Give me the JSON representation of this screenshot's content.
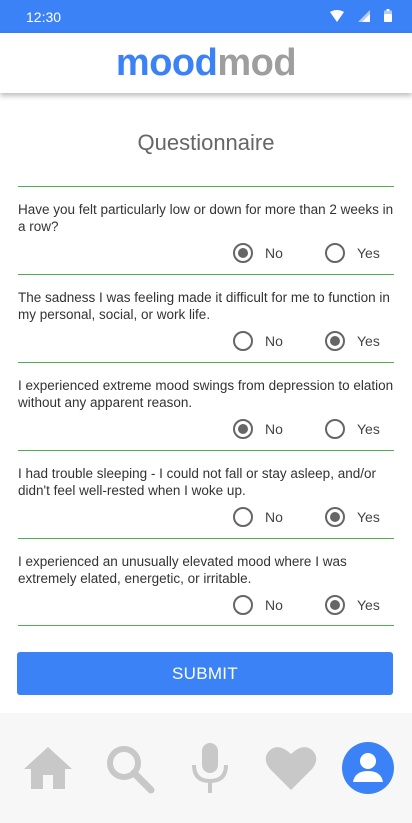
{
  "status_bar": {
    "time": "12:30"
  },
  "app": {
    "logo_part1": "mood",
    "logo_part2": "mod"
  },
  "page": {
    "title": "Questionnaire"
  },
  "questions": [
    {
      "text": "Have you felt particularly low or down for more than 2 weeks in a row?",
      "no_label": "No",
      "yes_label": "Yes",
      "selected": "No"
    },
    {
      "text": "The sadness I was feeling made it difficult for me to function in my personal, social, or work life.",
      "no_label": "No",
      "yes_label": "Yes",
      "selected": "Yes"
    },
    {
      "text": "I experienced extreme mood swings from depression to elation without any apparent reason.",
      "no_label": "No",
      "yes_label": "Yes",
      "selected": "No"
    },
    {
      "text": "I had trouble sleeping - I could not fall or stay asleep, and/or didn't feel well-rested when I woke up.",
      "no_label": "No",
      "yes_label": "Yes",
      "selected": "Yes"
    },
    {
      "text": "I experienced an unusually elevated mood where I was extremely elated, energetic, or irritable.",
      "no_label": "No",
      "yes_label": "Yes",
      "selected": "Yes"
    }
  ],
  "submit": {
    "label": "SUBMIT"
  },
  "bottom_nav": {
    "items": [
      {
        "icon": "home-icon"
      },
      {
        "icon": "search-icon"
      },
      {
        "icon": "microphone-icon"
      },
      {
        "icon": "heart-icon"
      },
      {
        "icon": "profile-icon",
        "active": true
      }
    ]
  },
  "colors": {
    "primary": "#3b82f6",
    "logo_gray": "#9e9e9e",
    "divider": "#4caf50",
    "nav_icon": "#c8c8c8"
  }
}
